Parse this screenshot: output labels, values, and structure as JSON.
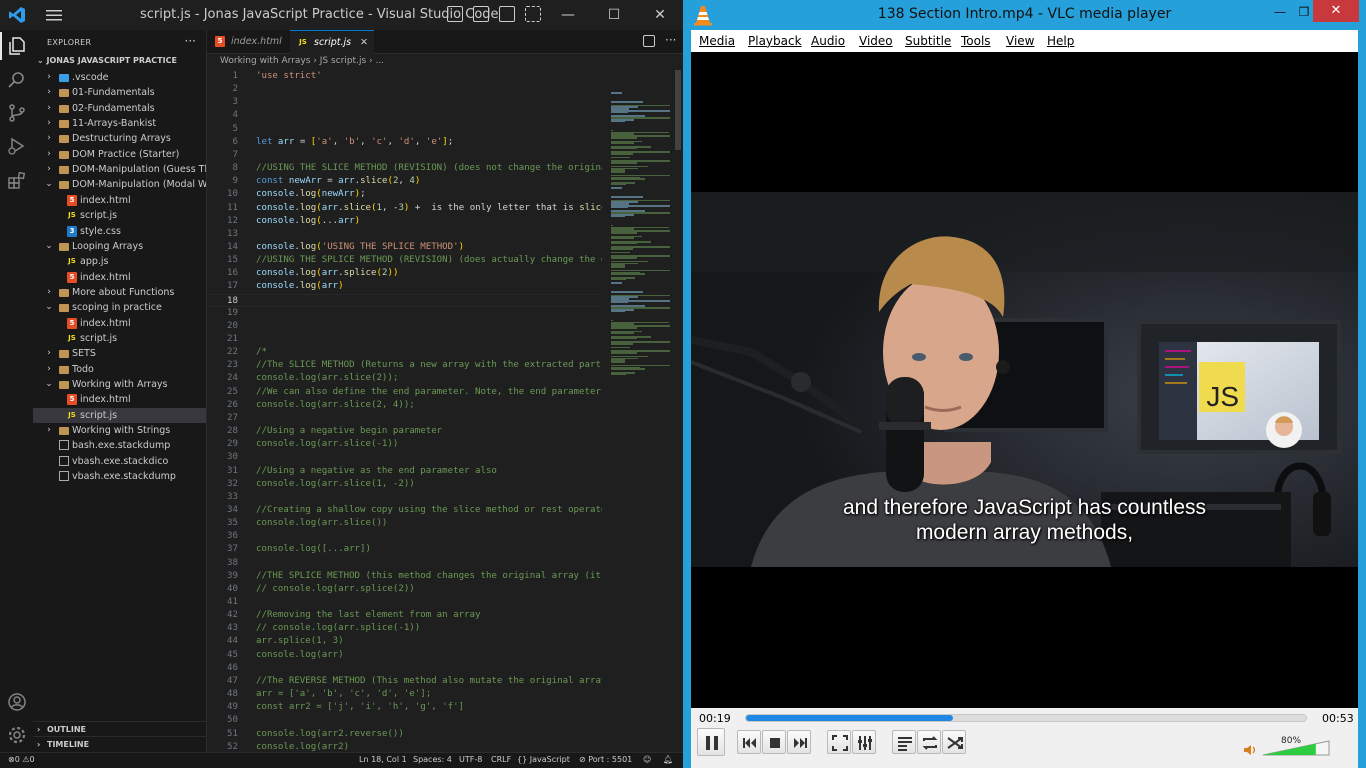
{
  "vscode": {
    "window_title": "script.js - Jonas JavaScript Practice - Visual Studio Code",
    "explorer_label": "EXPLORER",
    "explorer_more": "···",
    "root_label": "JONAS JAVASCRIPT PRACTICE",
    "tree": [
      {
        "label": ".vscode",
        "type": "vscode-folder",
        "depth": 0,
        "chevron": "›"
      },
      {
        "label": "01-Fundamentals",
        "type": "folder",
        "depth": 0,
        "chevron": "›"
      },
      {
        "label": "02-Fundamentals",
        "type": "folder",
        "depth": 0,
        "chevron": "›"
      },
      {
        "label": "11-Arrays-Bankist",
        "type": "folder",
        "depth": 0,
        "chevron": "›"
      },
      {
        "label": "Destructuring Arrays",
        "type": "folder",
        "depth": 0,
        "chevron": "›"
      },
      {
        "label": "DOM Practice (Starter)",
        "type": "folder",
        "depth": 0,
        "chevron": "›"
      },
      {
        "label": "DOM-Manipulation (Guess The ...",
        "type": "folder",
        "depth": 0,
        "chevron": "›"
      },
      {
        "label": "DOM-Manipulation (Modal Win...",
        "type": "folder",
        "depth": 0,
        "chevron": "⌄"
      },
      {
        "label": "index.html",
        "type": "html",
        "depth": 1,
        "chevron": ""
      },
      {
        "label": "script.js",
        "type": "js",
        "depth": 1,
        "chevron": ""
      },
      {
        "label": "style.css",
        "type": "css",
        "depth": 1,
        "chevron": ""
      },
      {
        "label": "Looping Arrays",
        "type": "folder",
        "depth": 0,
        "chevron": "⌄"
      },
      {
        "label": "app.js",
        "type": "js",
        "depth": 1,
        "chevron": ""
      },
      {
        "label": "index.html",
        "type": "html",
        "depth": 1,
        "chevron": ""
      },
      {
        "label": "More about Functions",
        "type": "folder",
        "depth": 0,
        "chevron": "›"
      },
      {
        "label": "scoping in practice",
        "type": "folder",
        "depth": 0,
        "chevron": "⌄"
      },
      {
        "label": "index.html",
        "type": "html",
        "depth": 1,
        "chevron": ""
      },
      {
        "label": "script.js",
        "type": "js",
        "depth": 1,
        "chevron": ""
      },
      {
        "label": "SETS",
        "type": "folder",
        "depth": 0,
        "chevron": "›"
      },
      {
        "label": "Todo",
        "type": "folder",
        "depth": 0,
        "chevron": "›"
      },
      {
        "label": "Working with Arrays",
        "type": "folder",
        "depth": 0,
        "chevron": "⌄"
      },
      {
        "label": "index.html",
        "type": "html",
        "depth": 1,
        "chevron": ""
      },
      {
        "label": "script.js",
        "type": "js",
        "depth": 1,
        "chevron": "",
        "selected": true
      },
      {
        "label": "Working with Strings",
        "type": "folder",
        "depth": 0,
        "chevron": "›"
      },
      {
        "label": "bash.exe.stackdump",
        "type": "file",
        "depth": 0,
        "chevron": ""
      },
      {
        "label": "vbash.exe.stackdico",
        "type": "file",
        "depth": 0,
        "chevron": ""
      },
      {
        "label": "vbash.exe.stackdump",
        "type": "file",
        "depth": 0,
        "chevron": ""
      }
    ],
    "outline_label": "OUTLINE",
    "timeline_label": "TIMELINE",
    "tabs": [
      {
        "label": "index.html",
        "icon": "html",
        "active": false
      },
      {
        "label": "script.js",
        "icon": "js",
        "active": true,
        "close": "✕"
      }
    ],
    "breadcrumb": "Working with Arrays  ›  JS script.js  ›  ...",
    "code_lines": [
      {
        "n": "1",
        "t": "'use strict'",
        "k": "str"
      },
      {
        "n": "2",
        "t": "",
        "k": "plain"
      },
      {
        "n": "3",
        "t": "",
        "k": "plain"
      },
      {
        "n": "4",
        "t": "",
        "k": "plain"
      },
      {
        "n": "5",
        "t": "",
        "k": "plain"
      },
      {
        "n": "6",
        "t": "let arr = ['a', 'b', 'c', 'd', 'e'];",
        "k": "let"
      },
      {
        "n": "7",
        "t": "",
        "k": "plain"
      },
      {
        "n": "8",
        "t": "//USING THE SLICE METHOD (REVISION) (does not change the original",
        "k": "com"
      },
      {
        "n": "9",
        "t": "const newArr = arr.slice(2, 4)",
        "k": "const"
      },
      {
        "n": "10",
        "t": "console.log(newArr);",
        "k": "call"
      },
      {
        "n": "11",
        "t": "console.log(arr.slice(1, -3) + ' is the only letter that is slice",
        "k": "call"
      },
      {
        "n": "12",
        "t": "console.log(...arr)",
        "k": "call"
      },
      {
        "n": "13",
        "t": "",
        "k": "plain"
      },
      {
        "n": "14",
        "t": "console.log('USING THE SPLICE METHOD')",
        "k": "call"
      },
      {
        "n": "15",
        "t": "//USING THE SPLICE METHOD (REVISION) (does actually change the or",
        "k": "com"
      },
      {
        "n": "16",
        "t": "console.log(arr.splice(2))",
        "k": "call"
      },
      {
        "n": "17",
        "t": "console.log(arr)",
        "k": "call"
      },
      {
        "n": "18",
        "t": "",
        "k": "plain",
        "current": true
      },
      {
        "n": "19",
        "t": "",
        "k": "plain"
      },
      {
        "n": "20",
        "t": "",
        "k": "plain"
      },
      {
        "n": "21",
        "t": "",
        "k": "plain"
      },
      {
        "n": "22",
        "t": "/*",
        "k": "com"
      },
      {
        "n": "23",
        "t": "//The SLICE METHOD (Returns a new array with the extracted part)",
        "k": "com"
      },
      {
        "n": "24",
        "t": "console.log(arr.slice(2));",
        "k": "com"
      },
      {
        "n": "25",
        "t": "//We can also define the end parameter. Note, the end parameter i",
        "k": "com"
      },
      {
        "n": "26",
        "t": "console.log(arr.slice(2, 4));",
        "k": "com"
      },
      {
        "n": "27",
        "t": "",
        "k": "plain"
      },
      {
        "n": "28",
        "t": "//Using a negative begin parameter",
        "k": "com"
      },
      {
        "n": "29",
        "t": "console.log(arr.slice(-1))",
        "k": "com"
      },
      {
        "n": "30",
        "t": "",
        "k": "plain"
      },
      {
        "n": "31",
        "t": "//Using a negative as the end parameter also",
        "k": "com"
      },
      {
        "n": "32",
        "t": "console.log(arr.slice(1, -2))",
        "k": "com"
      },
      {
        "n": "33",
        "t": "",
        "k": "plain"
      },
      {
        "n": "34",
        "t": "//Creating a shallow copy using the slice method or rest operator",
        "k": "com"
      },
      {
        "n": "35",
        "t": "console.log(arr.slice())",
        "k": "com"
      },
      {
        "n": "36",
        "t": "",
        "k": "plain"
      },
      {
        "n": "37",
        "t": "console.log([...arr])",
        "k": "com"
      },
      {
        "n": "38",
        "t": "",
        "k": "plain"
      },
      {
        "n": "39",
        "t": "//THE SPLICE METHOD (this method changes the original array (it m",
        "k": "com"
      },
      {
        "n": "40",
        "t": "// console.log(arr.splice(2))",
        "k": "com"
      },
      {
        "n": "41",
        "t": "",
        "k": "plain"
      },
      {
        "n": "42",
        "t": "//Removing the last element from an array",
        "k": "com"
      },
      {
        "n": "43",
        "t": "// console.log(arr.splice(-1))",
        "k": "com"
      },
      {
        "n": "44",
        "t": "arr.splice(1, 3)",
        "k": "com"
      },
      {
        "n": "45",
        "t": "console.log(arr)",
        "k": "com"
      },
      {
        "n": "46",
        "t": "",
        "k": "plain"
      },
      {
        "n": "47",
        "t": "//The REVERSE METHOD (This method also mutate the original array)",
        "k": "com"
      },
      {
        "n": "48",
        "t": "arr = ['a', 'b', 'c', 'd', 'e'];",
        "k": "com"
      },
      {
        "n": "49",
        "t": "const arr2 = ['j', 'i', 'h', 'g', 'f']",
        "k": "com"
      },
      {
        "n": "50",
        "t": "",
        "k": "plain"
      },
      {
        "n": "51",
        "t": "console.log(arr2.reverse())",
        "k": "com"
      },
      {
        "n": "52",
        "t": "console.log(arr2)",
        "k": "com"
      }
    ],
    "status": {
      "errors": "0",
      "warnings": "0",
      "position": "Ln 18, Col 1",
      "spaces": "Spaces: 4",
      "encoding": "UTF-8",
      "eol": "CRLF",
      "language": "JavaScript",
      "port": "Port : 5501"
    }
  },
  "vlc": {
    "window_title": "138 Section Intro.mp4 - VLC media player",
    "menu": [
      "Media",
      "Playback",
      "Audio",
      "Video",
      "Subtitle",
      "Tools",
      "View",
      "Help"
    ],
    "subtitle_lines": [
      "and therefore JavaScript has countless",
      "modern array methods,"
    ],
    "js_badge": "JS",
    "elapsed": "00:19",
    "duration": "00:53",
    "progress": 0.37,
    "volume_label": "80%",
    "volume": 0.8,
    "colors": {
      "title_bar": "#26a0da",
      "seek_fill": "#1e88e5",
      "volume_fill": "#2ecc40",
      "close_button": "#c7393c"
    }
  }
}
